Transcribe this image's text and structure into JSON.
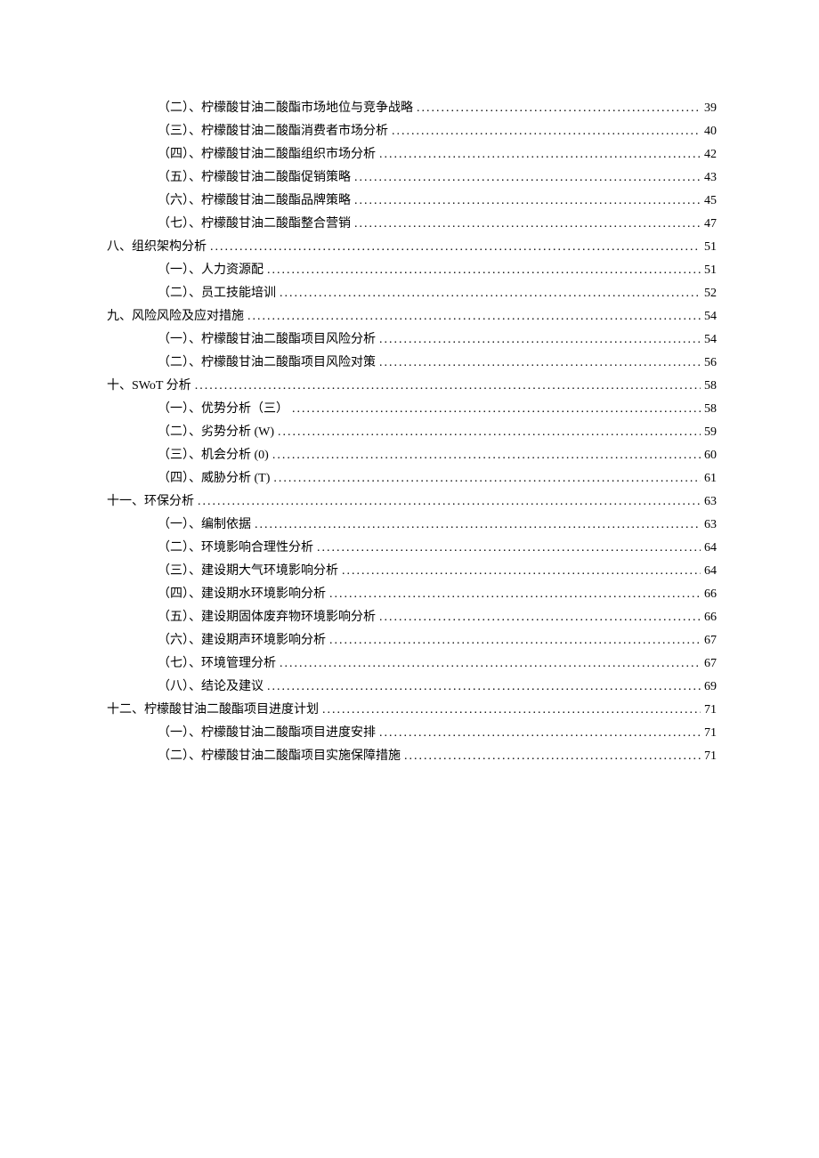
{
  "toc": [
    {
      "level": 2,
      "label": "（二）、柠檬酸甘油二酸酯市场地位与竞争战略",
      "page": "39"
    },
    {
      "level": 2,
      "label": "（三）、柠檬酸甘油二酸酯消费者市场分析",
      "page": "40"
    },
    {
      "level": 2,
      "label": "（四）、柠檬酸甘油二酸酯组织市场分析",
      "page": "42"
    },
    {
      "level": 2,
      "label": "（五）、柠檬酸甘油二酸酯促销策略",
      "page": "43"
    },
    {
      "level": 2,
      "label": "（六）、柠檬酸甘油二酸酯品牌策略",
      "page": "45"
    },
    {
      "level": 2,
      "label": "（七）、柠檬酸甘油二酸酯整合营销",
      "page": "47"
    },
    {
      "level": 1,
      "label": "八、组织架构分析 ",
      "page": "51"
    },
    {
      "level": 2,
      "label": "（一）、人力资源配",
      "page": "51"
    },
    {
      "level": 2,
      "label": "（二）、员工技能培训",
      "page": "52"
    },
    {
      "level": 1,
      "label": "九、风险风险及应对措施 ",
      "page": "54"
    },
    {
      "level": 2,
      "label": "（一）、柠檬酸甘油二酸酯项目风险分析",
      "page": "54"
    },
    {
      "level": 2,
      "label": "（二）、柠檬酸甘油二酸酯项目风险对策",
      "page": "56"
    },
    {
      "level": 1,
      "label": "十、SWoT 分析 ",
      "page": "58"
    },
    {
      "level": 2,
      "label": "（一）、优势分析（三）",
      "page": "58"
    },
    {
      "level": 2,
      "label": "（二）、劣势分析 (W) ",
      "page": "59"
    },
    {
      "level": 2,
      "label": "（三）、机会分析 (0) ",
      "page": "60"
    },
    {
      "level": 2,
      "label": "（四）、威胁分析 (T) ",
      "page": "61"
    },
    {
      "level": 1,
      "label": "十一、环保分析 ",
      "page": "63"
    },
    {
      "level": 2,
      "label": "（一）、编制依据",
      "page": "63"
    },
    {
      "level": 2,
      "label": "（二）、环境影响合理性分析",
      "page": "64"
    },
    {
      "level": 2,
      "label": "（三）、建设期大气环境影响分析",
      "page": "64"
    },
    {
      "level": 2,
      "label": "（四）、建设期水环境影响分析",
      "page": "66"
    },
    {
      "level": 2,
      "label": "（五）、建设期固体废弃物环境影响分析",
      "page": "66"
    },
    {
      "level": 2,
      "label": "（六）、建设期声环境影响分析",
      "page": "67"
    },
    {
      "level": 2,
      "label": "（七）、环境管理分析",
      "page": "67"
    },
    {
      "level": 2,
      "label": "（八）、结论及建议",
      "page": "69"
    },
    {
      "level": 1,
      "label": "十二、柠檬酸甘油二酸酯项目进度计划 ",
      "page": "71"
    },
    {
      "level": 2,
      "label": "（一）、柠檬酸甘油二酸酯项目进度安排",
      "page": "71"
    },
    {
      "level": 2,
      "label": "（二）、柠檬酸甘油二酸酯项目实施保障措施",
      "page": "71"
    }
  ]
}
